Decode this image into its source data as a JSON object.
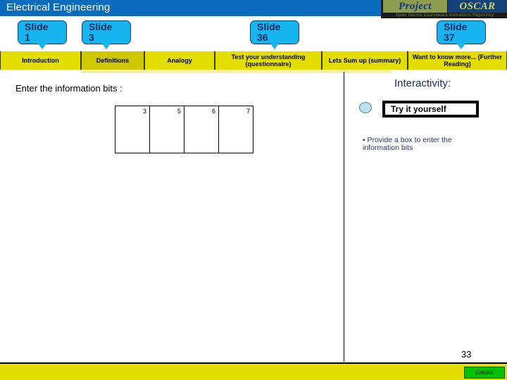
{
  "window": {
    "title": "Electrical Engineering"
  },
  "logo": {
    "word1": "Project",
    "word2": "OSCAR",
    "tagline": "Open Source Courseware Animations Repository"
  },
  "callouts": [
    {
      "label": "Slide",
      "number": "1"
    },
    {
      "label": "Slide",
      "number": "3"
    },
    {
      "label": "Slide",
      "number": "36"
    },
    {
      "label": "Slide",
      "number": "37"
    }
  ],
  "tabs": [
    {
      "label": "Introduction",
      "active": false
    },
    {
      "label": "Definitions",
      "active": true
    },
    {
      "label": "Analogy",
      "active": false
    },
    {
      "label": "Test your understanding (questionnaire)",
      "active": false
    },
    {
      "label": "Lets Sum up (summary)",
      "active": false
    },
    {
      "label": "Want to know more... (Further Reading)",
      "active": false
    }
  ],
  "slide": {
    "prompt": "Enter the information bits :",
    "bits": [
      {
        "value": "3"
      },
      {
        "value": "5"
      },
      {
        "value": "6"
      },
      {
        "value": "7"
      }
    ]
  },
  "interactivity": {
    "heading": "Interactivity:",
    "button_label": "Try it yourself",
    "note_bullet": "▪",
    "note": "Provide a box to enter the information bits"
  },
  "footer": {
    "page_number": "33",
    "credits_label": "Credits"
  },
  "colors": {
    "title_bar": "#0b6cbe",
    "tab": "#e3dd00",
    "tab_active": "#cfc700",
    "callout": "#17b5ef",
    "callout_text": "#0f2a63",
    "heading": "#1e2a5c",
    "credits": "#00c000"
  }
}
